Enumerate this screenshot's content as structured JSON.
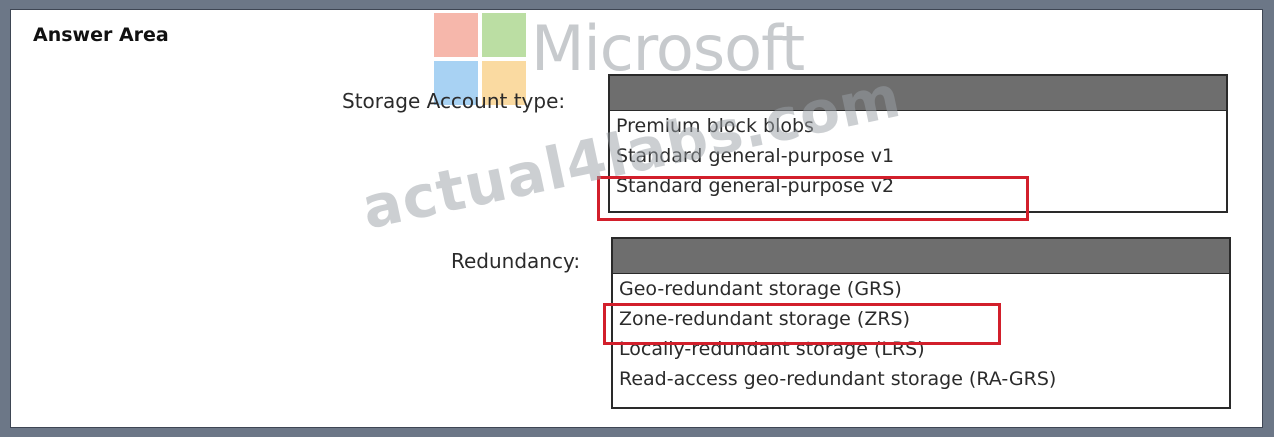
{
  "answer_area": {
    "title": "Answer Area"
  },
  "watermark": {
    "logo_colors": [
      "#f08b78",
      "#92c96a",
      "#73b6ec",
      "#f7c467"
    ],
    "brand_word": "Microsoft",
    "site_text": "actual4labs.com"
  },
  "storage_account_type": {
    "label": "Storage Account type:",
    "options": [
      {
        "label": "Premium block blobs",
        "selected": false
      },
      {
        "label": "Standard general-purpose v1",
        "selected": false
      },
      {
        "label": "Standard general-purpose v2",
        "selected": true
      }
    ]
  },
  "redundancy": {
    "label": "Redundancy:",
    "options": [
      {
        "label": "Geo-redundant storage (GRS)",
        "selected": false
      },
      {
        "label": "Zone-redundant storage (ZRS)",
        "selected": true
      },
      {
        "label": "Locally-redundant storage (LRS)",
        "selected": false
      },
      {
        "label": "Read-access geo-redundant storage (RA-GRS)",
        "selected": false
      }
    ]
  },
  "colors": {
    "selection_highlight": "#d21f2b",
    "dropdown_header": "#6e6e6e",
    "page_border": "#6c7787"
  }
}
